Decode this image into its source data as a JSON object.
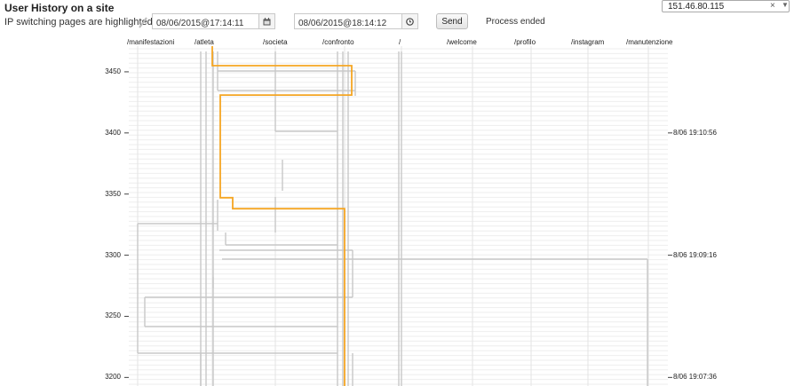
{
  "header": {
    "title": "User History on a site",
    "subtitle": "IP switching pages are highlighted as:",
    "start_datetime": "08/06/2015@17:14:11",
    "end_datetime": "08/06/2015@18:14:12",
    "send_label": "Send",
    "status": "Process ended",
    "ip_selected": "151.46.80.115",
    "clear_glyph": "×",
    "dropdown_glyph": "▼"
  },
  "colors": {
    "highlight": "#f5a623",
    "path": "#c8c8c8",
    "grid": "#eeeeee",
    "axis": "#444444"
  },
  "icons": {
    "start_picker": "calendar-icon",
    "end_picker": "clock-icon",
    "legend": "highlight-line-icon"
  },
  "chart_data": {
    "type": "line",
    "pages": [
      "/manifestazioni",
      "/atleta",
      "/societa",
      "/confronto",
      "/",
      "/welcome",
      "/profilo",
      "/instagram",
      "/manutenzione"
    ],
    "y_ticks": [
      "3450",
      "3400",
      "3350",
      "3300",
      "3250",
      "3200"
    ],
    "y_tick_values": [
      3450,
      3400,
      3350,
      3300,
      3250,
      3200
    ],
    "ylim": [
      3193,
      3471
    ],
    "time_ticks": [
      {
        "value": 3400,
        "label": "8/06 19:10:56"
      },
      {
        "value": 3300,
        "label": "8/06 19:09:16"
      },
      {
        "value": 3200,
        "label": "8/06 19:07:36"
      }
    ],
    "highlighted_path": [
      [
        "/atleta",
        3471
      ],
      [
        "/atleta",
        3455
      ],
      [
        "/confronto",
        3455
      ],
      [
        "/confronto",
        3431
      ],
      [
        "/atleta",
        3431
      ],
      [
        "/atleta",
        3347
      ],
      [
        "/atleta",
        3347
      ],
      [
        "/atleta",
        3338
      ],
      [
        "/confronto",
        3338
      ],
      [
        "/confronto",
        3193
      ]
    ]
  }
}
